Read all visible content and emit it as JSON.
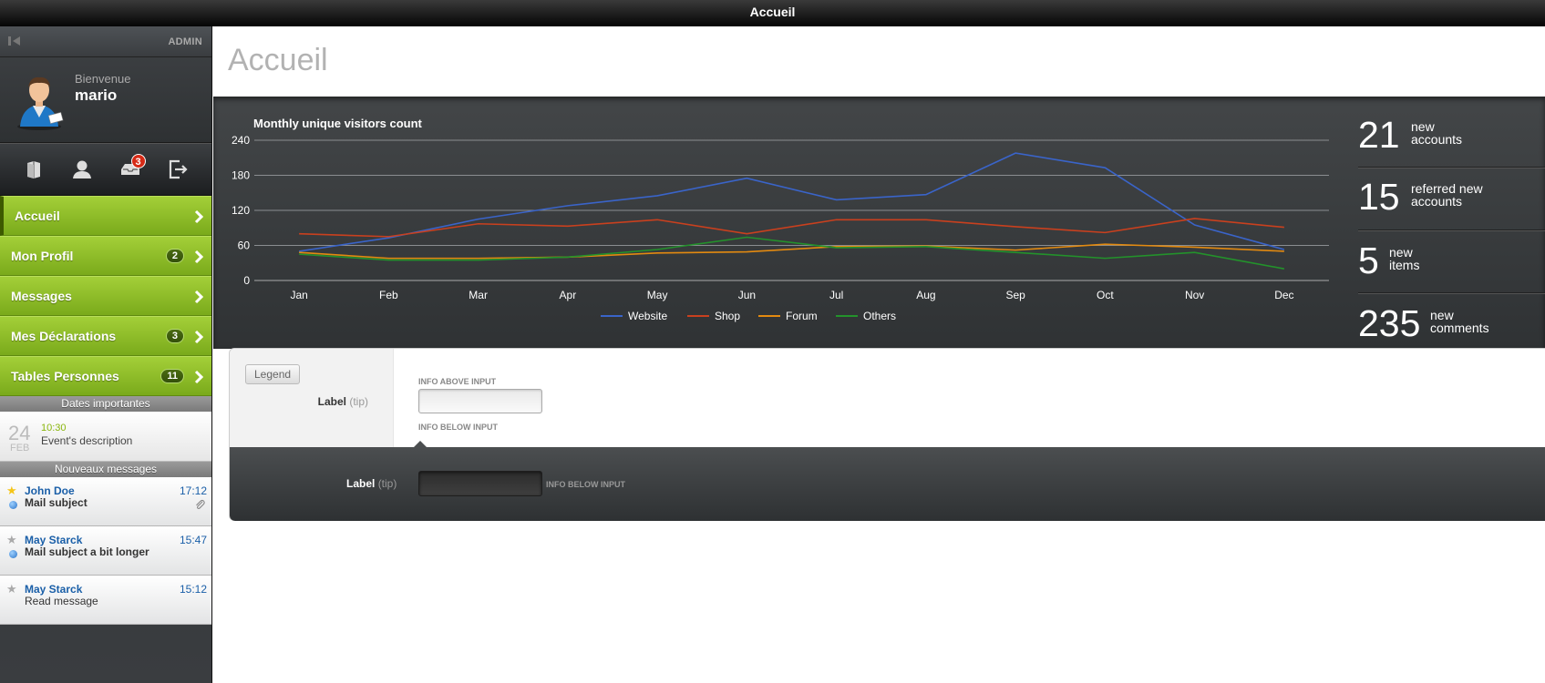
{
  "window": {
    "title": "Accueil"
  },
  "sidebar": {
    "admin_label": "ADMIN",
    "user": {
      "welcome": "Bienvenue",
      "name": "mario"
    },
    "toolbar": {
      "inbox_badge": "3"
    },
    "nav": [
      {
        "label": "Accueil",
        "count": null,
        "active": true
      },
      {
        "label": "Mon Profil",
        "count": "2"
      },
      {
        "label": "Messages",
        "count": null
      },
      {
        "label": "Mes Déclarations",
        "count": "3"
      },
      {
        "label": "Tables Personnes",
        "count": "11"
      }
    ],
    "dates_title": "Dates importantes",
    "event": {
      "day": "24",
      "month": "FEB",
      "time": "10:30",
      "description": "Event's description"
    },
    "messages_title": "Nouveaux messages",
    "messages": [
      {
        "from": "John Doe",
        "time": "17:12",
        "subject": "Mail subject",
        "starred": true,
        "unread": true,
        "attachment": true
      },
      {
        "from": "May Starck",
        "time": "15:47",
        "subject": "Mail subject a bit longer",
        "starred": false,
        "unread": true,
        "attachment": false
      },
      {
        "from": "May Starck",
        "time": "15:12",
        "subject": "Read message",
        "starred": false,
        "unread": false,
        "attachment": false
      }
    ]
  },
  "main": {
    "page_title": "Accueil",
    "stats": [
      {
        "value": "21",
        "label_line1": "new",
        "label_line2": "accounts"
      },
      {
        "value": "15",
        "label_line1": "referred new",
        "label_line2": "accounts"
      },
      {
        "value": "5",
        "label_line1": "new",
        "label_line2": "items"
      },
      {
        "value": "235",
        "label_line1": "new",
        "label_line2": "comments"
      }
    ],
    "form": {
      "legend": "Legend",
      "row1": {
        "label": "Label",
        "tip": "(tip)",
        "info_above": "INFO ABOVE INPUT",
        "info_below": "INFO BELOW INPUT",
        "value": ""
      },
      "row2": {
        "label": "Label",
        "tip": "(tip)",
        "info_below": "INFO BELOW INPUT",
        "value": ""
      }
    }
  },
  "chart_data": {
    "type": "line",
    "title": "Monthly unique visitors count",
    "categories": [
      "Jan",
      "Feb",
      "Mar",
      "Apr",
      "May",
      "Jun",
      "Jul",
      "Aug",
      "Sep",
      "Oct",
      "Nov",
      "Dec"
    ],
    "ylim": [
      0,
      240
    ],
    "yticks": [
      0,
      60,
      120,
      180,
      240
    ],
    "grid": true,
    "legend_position": "bottom",
    "series": [
      {
        "name": "Website",
        "color": "#3a64c9",
        "values": [
          50,
          73,
          105,
          128,
          145,
          175,
          138,
          147,
          218,
          193,
          95,
          53
        ]
      },
      {
        "name": "Shop",
        "color": "#c9401e",
        "values": [
          80,
          75,
          97,
          93,
          104,
          80,
          104,
          104,
          92,
          82,
          106,
          91
        ]
      },
      {
        "name": "Forum",
        "color": "#e38a10",
        "values": [
          48,
          38,
          38,
          40,
          47,
          49,
          58,
          59,
          52,
          62,
          57,
          50
        ]
      },
      {
        "name": "Others",
        "color": "#23922b",
        "values": [
          45,
          35,
          35,
          40,
          53,
          74,
          56,
          58,
          48,
          38,
          48,
          20
        ]
      }
    ]
  }
}
